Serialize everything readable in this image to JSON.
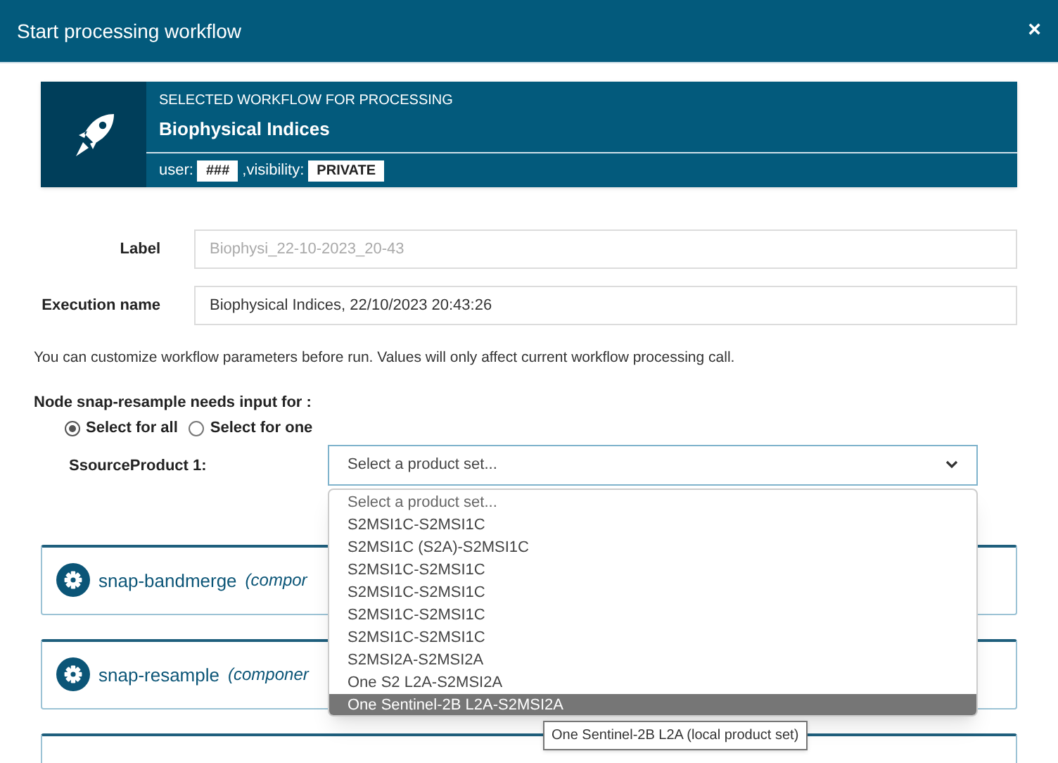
{
  "window": {
    "title": "Start processing workflow",
    "close": "×"
  },
  "workflow": {
    "caption": "SELECTED WORKFLOW FOR PROCESSING",
    "name": "Biophysical Indices",
    "user_label": "user:",
    "user": "###",
    "visibility_label": ",visibility:",
    "visibility": "PRIVATE"
  },
  "fields": [
    {
      "label": "Label",
      "placeholder": "Biophysi_22-10-2023_20-43"
    },
    {
      "label": "Execution name",
      "value": "Biophysical Indices, 22/10/2023 20:43:26"
    }
  ],
  "hint": "You can customize workflow parameters before run. Values will only affect current workflow processing call.",
  "node_input": {
    "title": "Node snap-resample needs input for :",
    "options": [
      {
        "label": "Select for all",
        "selected": true
      },
      {
        "label": "Select for one",
        "selected": false
      }
    ],
    "product_label": "SsourceProduct 1:",
    "select": "Select a product set...",
    "options_list": [
      {
        "label": "Select a product set...",
        "selected": false,
        "kind": "placeholder"
      },
      {
        "label": "S2MSI1C-S2MSI1C",
        "selected": false,
        "kind": "option"
      },
      {
        "label": "S2MSI1C (S2A)-S2MSI1C",
        "selected": false,
        "kind": "option"
      },
      {
        "label": "S2MSI1C-S2MSI1C",
        "selected": false,
        "kind": "option"
      },
      {
        "label": "S2MSI1C-S2MSI1C",
        "selected": false,
        "kind": "option"
      },
      {
        "label": "S2MSI1C-S2MSI1C",
        "selected": false,
        "kind": "option"
      },
      {
        "label": "S2MSI1C-S2MSI1C",
        "selected": false,
        "kind": "option"
      },
      {
        "label": "S2MSI2A-S2MSI2A",
        "selected": false,
        "kind": "option"
      },
      {
        "label": "One S2 L2A-S2MSI2A",
        "selected": false,
        "kind": "option"
      },
      {
        "label": "One Sentinel-2B L2A-S2MSI2A",
        "selected": true,
        "kind": "option"
      }
    ],
    "tooltip": "One Sentinel-2B L2A (local product set)"
  },
  "components": [
    {
      "kind": "full",
      "name": "snap-bandmerge",
      "suffix": "(compor"
    },
    {
      "kind": "full",
      "name": "snap-resample",
      "suffix": "(componer"
    },
    {
      "kind": "cut"
    }
  ]
}
